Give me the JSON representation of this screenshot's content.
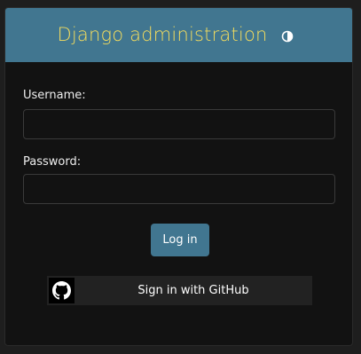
{
  "header": {
    "title": "Django administration",
    "theme_toggle_icon": "half-circle-contrast-icon"
  },
  "form": {
    "username_label": "Username:",
    "username_value": "",
    "password_label": "Password:",
    "password_value": "",
    "login_button": "Log in"
  },
  "social": {
    "github_label": "Sign in with GitHub",
    "github_icon": "github-icon"
  },
  "colors": {
    "header_bg": "#417690",
    "title_color": "#f5dd5d",
    "panel_bg": "#121212",
    "button_bg": "#417690"
  }
}
